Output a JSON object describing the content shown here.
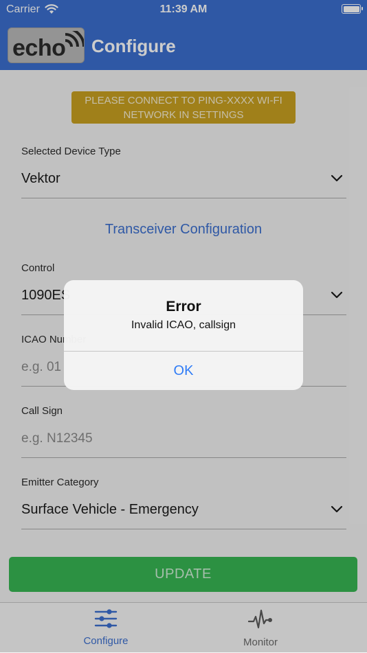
{
  "status_bar": {
    "carrier": "Carrier",
    "time": "11:39 AM"
  },
  "nav": {
    "logo_text": "echo",
    "title": "Configure"
  },
  "banner": {
    "line1": "PLEASE CONNECT TO PING-XXXX WI-FI",
    "line2": "NETWORK IN SETTINGS"
  },
  "device_type": {
    "label": "Selected Device Type",
    "value": "Vektor"
  },
  "section_link": "Transceiver Configuration",
  "control": {
    "label": "Control",
    "value": "1090ES"
  },
  "icao": {
    "label": "ICAO Number",
    "placeholder": "e.g. 01"
  },
  "call_sign": {
    "label": "Call Sign",
    "placeholder": "e.g. N12345"
  },
  "emitter": {
    "label": "Emitter Category",
    "value": "Surface Vehicle - Emergency"
  },
  "update_button": "UPDATE",
  "tabs": [
    {
      "label": "Configure",
      "icon": "sliders-icon",
      "active": true
    },
    {
      "label": "Monitor",
      "icon": "heartbeat-icon",
      "active": false
    }
  ],
  "alert": {
    "title": "Error",
    "message": "Invalid ICAO, callsign",
    "ok": "OK"
  },
  "colors": {
    "nav_blue": "#3b6fcf",
    "banner_gold": "#c9a021",
    "update_green": "#37b653",
    "ios_blue": "#2f7cf6"
  }
}
